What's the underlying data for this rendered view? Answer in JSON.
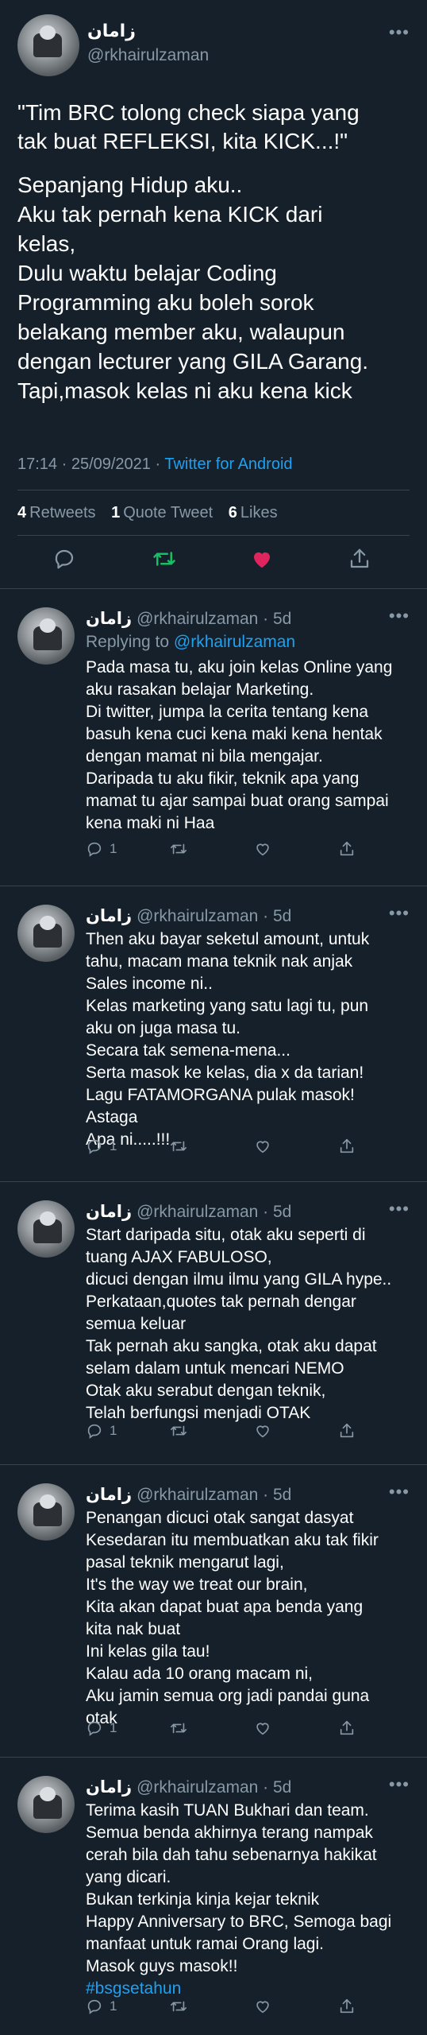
{
  "tweet": {
    "display_name": "زامان",
    "handle": "@rkhairulzaman",
    "quote": "\"Tim BRC tolong check siapa yang\ntak buat REFLEKSI, kita KICK...!\"",
    "body": "Sepanjang Hidup aku..\nAku tak pernah kena KICK dari\nkelas,\nDulu waktu belajar Coding\nProgramming  aku boleh sorok\nbelakang member aku, walaupun\ndengan lecturer yang GILA Garang.\nTapi,masok kelas ni aku kena kick",
    "time": "17:14 · 25/09/2021 · ",
    "source": "Twitter for Android",
    "stats": {
      "retweets_count": "4",
      "retweets_label": "Retweets",
      "quotes_count": "1",
      "quotes_label": "Quote Tweet",
      "likes_count": "6",
      "likes_label": "Likes"
    }
  },
  "icons": {
    "more": "more-icon",
    "reply": "reply-icon",
    "retweet": "retweet-icon",
    "like": "heart-icon",
    "share": "share-icon"
  },
  "colors": {
    "background": "#15202b",
    "secondary_text": "#8899a6",
    "link": "#1da1f2",
    "retweet_active": "#17bf63",
    "like_active": "#e0245e",
    "divider": "#38444d"
  },
  "replies": [
    {
      "name": "زامان",
      "handle": "@rkhairulzaman",
      "age": "· 5d",
      "replying_prefix": "Replying to ",
      "replying_to": "@rkhairulzaman",
      "text": "Pada masa tu, aku join kelas Online yang\naku rasakan belajar Marketing.\nDi twitter, jumpa la cerita tentang kena\nbasuh kena cuci kena maki kena hentak\ndengan mamat ni bila mengajar.\nDaripada tu aku fikir, teknik apa yang\nmamat tu ajar sampai buat orang sampai\nkena maki ni Haa",
      "reply_count": "1"
    },
    {
      "name": "زامان",
      "handle": "@rkhairulzaman",
      "age": "· 5d",
      "text": "Then aku bayar seketul amount, untuk\ntahu, macam mana teknik nak anjak\nSales income ni..\nKelas marketing yang satu lagi tu, pun\naku on juga masa tu.\nSecara tak semena-mena...\nSerta masok ke kelas, dia x da tarian!\nLagu FATAMORGANA pulak masok!\nAstaga\nApa ni.....!!!",
      "reply_count": "1"
    },
    {
      "name": "زامان",
      "handle": "@rkhairulzaman",
      "age": "· 5d",
      "text": "Start daripada situ, otak aku seperti di\ntuang AJAX FABULOSO,\ndicuci dengan ilmu ilmu yang GILA hype..\nPerkataan,quotes tak pernah dengar\nsemua keluar\nTak pernah aku sangka, otak aku dapat\nselam dalam untuk mencari NEMO\nOtak aku serabut dengan teknik,\nTelah berfungsi menjadi OTAK",
      "reply_count": "1"
    },
    {
      "name": "زامان",
      "handle": "@rkhairulzaman",
      "age": "· 5d",
      "text": "Penangan dicuci otak sangat dasyat\nKesedaran itu membuatkan aku tak fikir\npasal teknik mengarut lagi,\nIt's the way we treat our brain,\nKita akan dapat buat apa benda yang\nkita nak buat\nIni kelas gila tau!\nKalau ada 10 orang macam ni,\nAku jamin semua org jadi pandai guna\notak",
      "reply_count": "1"
    },
    {
      "name": "زامان",
      "handle": "@rkhairulzaman",
      "age": "· 5d",
      "text": "Terima kasih TUAN Bukhari dan team.\nSemua benda akhirnya terang nampak\ncerah bila dah tahu sebenarnya hakikat\nyang dicari.\nBukan terkinja kinja kejar teknik\nHappy Anniversary to BRC, Semoga bagi\nmanfaat untuk ramai Orang lagi.\nMasok guys masok!!",
      "hashtag": "#bsgsetahun",
      "reply_count": "1"
    }
  ]
}
